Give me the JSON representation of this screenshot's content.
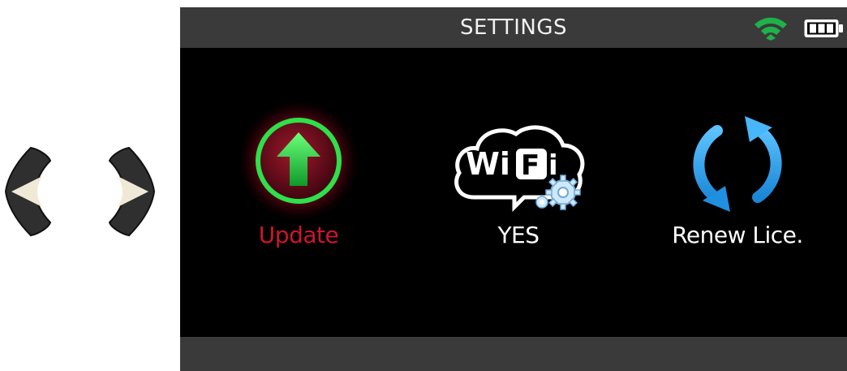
{
  "header": {
    "title": "SETTINGS",
    "wifi_icon": "wifi-signal-icon",
    "battery_icon": "battery-full-icon",
    "wifi_color": "#1fb14a"
  },
  "navigation": {
    "left_key_icon": "arrow-left-icon",
    "right_key_icon": "arrow-right-icon"
  },
  "menu": {
    "selected_index": 0,
    "selected_color": "#d0142c",
    "items": [
      {
        "label": "Update",
        "icon": "upload-arrow-icon"
      },
      {
        "label": "YES",
        "icon": "wifi-settings-icon",
        "badge_text": "WiFi"
      },
      {
        "label": "Renew Lice.",
        "icon": "refresh-cycle-icon"
      }
    ]
  }
}
